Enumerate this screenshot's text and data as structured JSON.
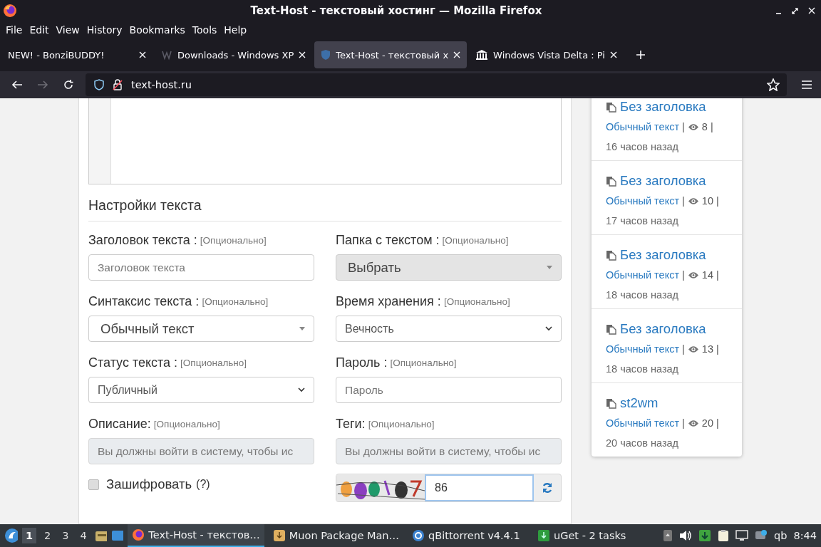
{
  "window": {
    "title": "Text-Host - текстовый хостинг — Mozilla Firefox"
  },
  "menu": [
    "File",
    "Edit",
    "View",
    "History",
    "Bookmarks",
    "Tools",
    "Help"
  ],
  "tabs": [
    {
      "label": "NEW! - BonziBUDDY!",
      "selected": false
    },
    {
      "label": "Downloads - Windows XP",
      "selected": false
    },
    {
      "label": "Text-Host - текстовый х",
      "selected": true
    },
    {
      "label": "Windows Vista Delta : Pi",
      "selected": false
    }
  ],
  "address": {
    "url": "text-host.ru"
  },
  "form": {
    "heading": "Настройки текста",
    "fields": [
      {
        "label": "Заголовок текста :",
        "hint": "[Опционально]",
        "kind": "input",
        "placeholder": "Заголовок текста",
        "disabled": false
      },
      {
        "label": "Папка с текстом :",
        "hint": "[Опционально]",
        "kind": "select2",
        "value": "Выбрать",
        "disabled": true
      },
      {
        "label": "Синтаксис текста :",
        "hint": "[Опционально]",
        "kind": "select2",
        "value": "Обычный текст",
        "disabled": false
      },
      {
        "label": "Время хранения :",
        "hint": "[Опционально]",
        "kind": "select",
        "value": "Вечность",
        "disabled": false
      },
      {
        "label": "Статус текста :",
        "hint": "[Опционально]",
        "kind": "select",
        "value": "Публичный",
        "disabled": false
      },
      {
        "label": "Пароль :",
        "hint": "[Опционально]",
        "kind": "input",
        "placeholder": "Пароль",
        "disabled": false
      },
      {
        "label": "Описание:",
        "hint": "[Опционально]",
        "kind": "input",
        "placeholder": "Вы должны войти в систему, чтобы ис",
        "disabled": true
      },
      {
        "label": "Теги:",
        "hint": "[Опционально]",
        "kind": "input",
        "placeholder": "Вы должны войти в систему, чтобы ис",
        "disabled": true
      }
    ],
    "encrypt": {
      "label": "Зашифровать",
      "help": "(?)",
      "checked": false
    },
    "captcha": {
      "kind": "picture",
      "value": "86",
      "focused": true
    }
  },
  "sidebar": {
    "items": [
      {
        "title": "Без заголовка",
        "syntax": "Обычный текст",
        "separator": "|",
        "views": "8 |",
        "age": "16 часов назад"
      },
      {
        "title": "Без заголовка",
        "syntax": "Обычный текст",
        "separator": "|",
        "views": "10 |",
        "age": "17 часов назад"
      },
      {
        "title": "Без заголовка",
        "syntax": "Обычный текст",
        "separator": "|",
        "views": "14 |",
        "age": "18 часов назад"
      },
      {
        "title": "Без заголовка",
        "syntax": "Обычный текст",
        "separator": "|",
        "views": "13 |",
        "age": "18 часов назад"
      },
      {
        "title": "st2wm",
        "syntax": "Обычный текст",
        "separator": "|",
        "views": "20 |",
        "age": "20 часов назад"
      }
    ]
  },
  "taskbar": {
    "workspaces": [
      {
        "label": "1",
        "selected": true
      },
      {
        "label": "2",
        "selected": false
      },
      {
        "label": "3",
        "selected": false
      },
      {
        "label": "4",
        "selected": false
      }
    ],
    "windows": [
      {
        "label": "Text-Host - текстов…",
        "selected": true
      },
      {
        "label": "Muon Package Man…",
        "selected": false
      },
      {
        "label": "qBittorrent v4.4.1",
        "selected": false
      },
      {
        "label": "uGet - 2 tasks",
        "selected": false
      }
    ],
    "tray_text": "qb",
    "clock": "8:44"
  }
}
